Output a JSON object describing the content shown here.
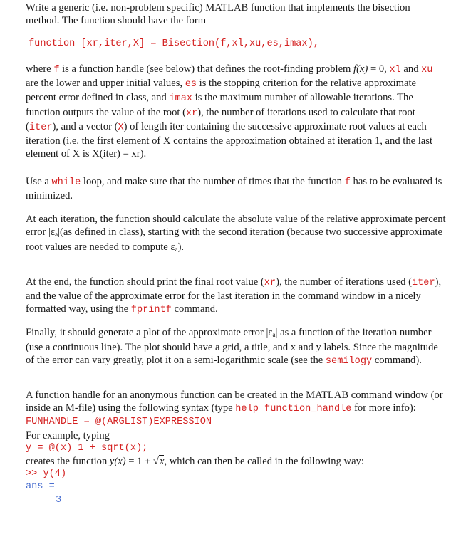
{
  "p1": {
    "text": "Write a generic (i.e. non-problem specific) MATLAB function that implements the bisection method. The function should have the form"
  },
  "signature": "function [xr,iter,X] = Bisection(f,xl,xu,es,imax),",
  "p3": {
    "t1": "where ",
    "c_f": "f",
    "t2": " is a function handle (see below) that defines the root-finding problem ",
    "math_f": "f(x)",
    "math_eq": " = 0",
    "t3": ", ",
    "c_xl": "xl",
    "t4": " and ",
    "c_xu": "xu",
    "t5": " are the lower and upper initial values, ",
    "c_es": "es",
    "t6": " is the stopping criterion for the relative approximate percent error defined in class, and ",
    "c_imax": "imax",
    "t7": " is the maximum number of allowable iterations. The function outputs the value of the root (",
    "c_xr": "xr",
    "t8": "), the number of iterations used to calculate that root (",
    "c_iter": "iter",
    "t9": "), and a vector (",
    "c_X": "X",
    "t10": ") of length iter containing the successive approximate root values at each iteration (i.e. the first element of X contains the approximation obtained at iteration 1, and the last element of X is X(iter) = xr)."
  },
  "p4": {
    "t1": "Use a ",
    "c_while": "while",
    "t2": " loop, and make sure that the number of times that the function ",
    "c_f": "f",
    "t3": " has to be evaluated is minimized."
  },
  "p5": {
    "t1": "At each iteration, the function should calculate the absolute value of the relative approximate percent error |",
    "eps": "ε",
    "sub": "a",
    "t2": "|(as defined in class), starting with the second iteration (because two successive approximate root values are needed to compute ",
    "eps2": "ε",
    "sub2": "a",
    "t3": ")."
  },
  "p6": {
    "t1": "At the end, the function should print the final root value (",
    "c_xr": "xr",
    "t2": "), the number of iterations used (",
    "c_iter": "iter",
    "t3": "), and the value of the approximate error for the last iteration in the command window in a nicely formatted way, using the ",
    "c_fprintf": "fprintf",
    "t4": "  command."
  },
  "p7": {
    "t1": "Finally, it should generate a plot of the approximate error |",
    "eps": "ε",
    "sub": "a",
    "t2": "| as a function of the iteration number (use a continuous line). The plot should have a grid, a title, and x and y labels. Since the magnitude of the error can vary greatly, plot it on a semi-logarithmic scale (see the ",
    "c_semilogy": "semilogy",
    "t3": "  command)."
  },
  "p8": {
    "t1": "A ",
    "link": "function handle",
    "t2": " for an anonymous function can be created in the MATLAB command window (or inside an M-file) using the following syntax (type ",
    "c_help": "help function_handle",
    "t3": "  for more info):",
    "syntax": "FUNHANDLE = @(ARGLIST)EXPRESSION",
    "example_intro": "For example, typing",
    "example_code": "y = @(x) 1 + sqrt(x);",
    "creates_t1": "creates the function ",
    "math_y": "y(x)",
    "math_eq": " = 1 + ",
    "math_sqrt_arg": "x",
    "creates_t2": ", which can then be called in the following way:",
    "call": ">> y(4)",
    "ans_label": "ans =",
    "ans_value": "3"
  }
}
